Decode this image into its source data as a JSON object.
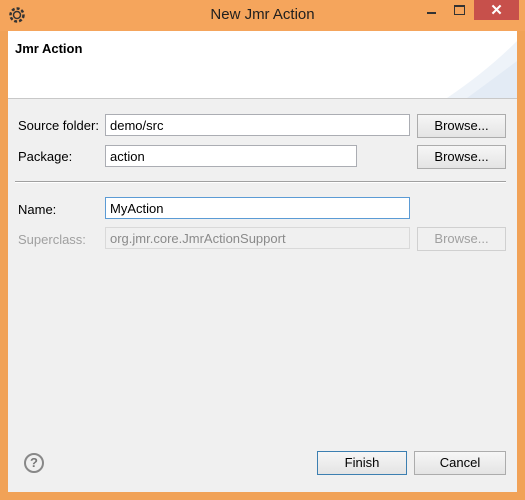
{
  "window": {
    "title": "New Jmr Action",
    "close_glyph": "✕"
  },
  "banner": {
    "title": "Jmr Action"
  },
  "form": {
    "source_folder": {
      "label": "Source folder:",
      "value": "demo/src",
      "button": "Browse..."
    },
    "package": {
      "label": "Package:",
      "value": "action",
      "button": "Browse..."
    },
    "name": {
      "label": "Name:",
      "value": "MyAction"
    },
    "superclass": {
      "label": "Superclass:",
      "value": "org.jmr.core.JmrActionSupport",
      "button": "Browse..."
    }
  },
  "footer": {
    "help_glyph": "?",
    "finish": "Finish",
    "cancel": "Cancel"
  }
}
